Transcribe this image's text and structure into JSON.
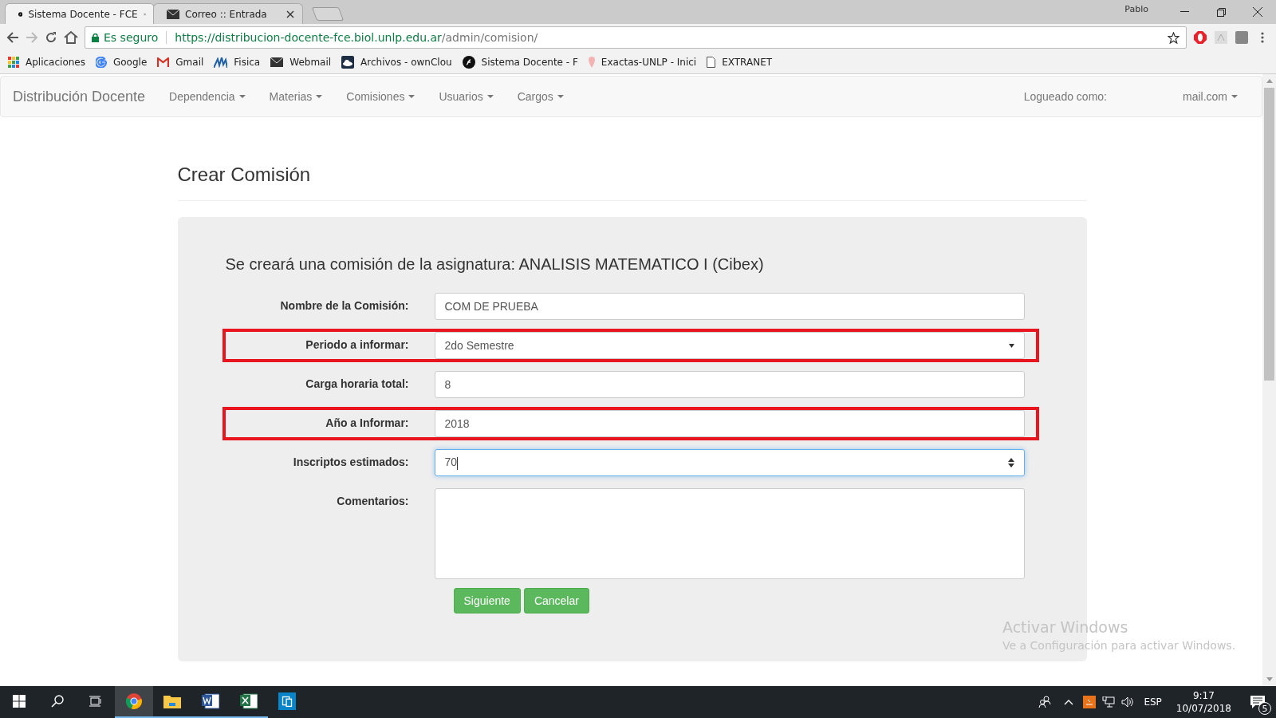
{
  "browser": {
    "tabs": [
      {
        "title": "Sistema Docente - FCE",
        "kind": "symfony",
        "selected": true
      },
      {
        "title": "Correo :: Entrada",
        "kind": "mail",
        "selected": false
      }
    ],
    "profile": "Pablo",
    "security": "Es seguro",
    "url_host": "https://distribucion-docente-fce.biol.unlp.edu.ar",
    "url_path": "/admin/comision/",
    "bookmarks": [
      {
        "label": "Aplicaciones",
        "kind": "apps"
      },
      {
        "label": "Google",
        "kind": "google"
      },
      {
        "label": "Gmail",
        "kind": "gmail"
      },
      {
        "label": "Fisica",
        "kind": "wave"
      },
      {
        "label": "Webmail",
        "kind": "mail"
      },
      {
        "label": "Archivos - ownClou",
        "kind": "cloud"
      },
      {
        "label": "Sistema Docente - F",
        "kind": "symfony"
      },
      {
        "label": "Exactas-UNLP - Inici",
        "kind": "pin"
      },
      {
        "label": "EXTRANET",
        "kind": "page"
      }
    ]
  },
  "navbar": {
    "brand": "Distribución Docente",
    "menus": [
      "Dependencia",
      "Materias",
      "Comisiones",
      "Usuarios",
      "Cargos"
    ],
    "logged_label": "Logueado como:",
    "user": "mail.com"
  },
  "page": {
    "title": "Crear Comisión",
    "intro": "Se creará una comisión de la asignatura: ANALISIS MATEMATICO I (Cibex)",
    "fields": [
      {
        "label": "Nombre de la Comisión:",
        "kind": "text",
        "value": "COM DE PRUEBA",
        "highlighted": false,
        "focused": false
      },
      {
        "label": "Periodo a informar:",
        "kind": "select",
        "value": "2do Semestre",
        "highlighted": true,
        "focused": false
      },
      {
        "label": "Carga horaria total:",
        "kind": "text",
        "value": "8",
        "highlighted": false,
        "focused": false
      },
      {
        "label": "Año a Informar:",
        "kind": "text",
        "value": "2018",
        "highlighted": true,
        "focused": false
      },
      {
        "label": "Inscriptos estimados:",
        "kind": "number",
        "value": "70",
        "highlighted": false,
        "focused": true
      },
      {
        "label": "Comentarios:",
        "kind": "textarea",
        "highlighted": false,
        "focused": false
      }
    ],
    "buttons": [
      "Siguiente",
      "Cancelar"
    ]
  },
  "activation": {
    "title": "Activar Windows",
    "message": "Ve a Configuración para activar Windows."
  },
  "taskbar": {
    "apps": [
      {
        "kind": "chrome",
        "running": true,
        "selected": true
      },
      {
        "kind": "folder",
        "running": true,
        "selected": false
      },
      {
        "kind": "word",
        "running": true,
        "selected": false
      },
      {
        "kind": "excel",
        "running": true,
        "selected": false
      },
      {
        "kind": "store",
        "running": false,
        "selected": false
      }
    ],
    "language": "ESP",
    "time": "9:17",
    "date": "10/07/2018",
    "notifications": "5"
  }
}
